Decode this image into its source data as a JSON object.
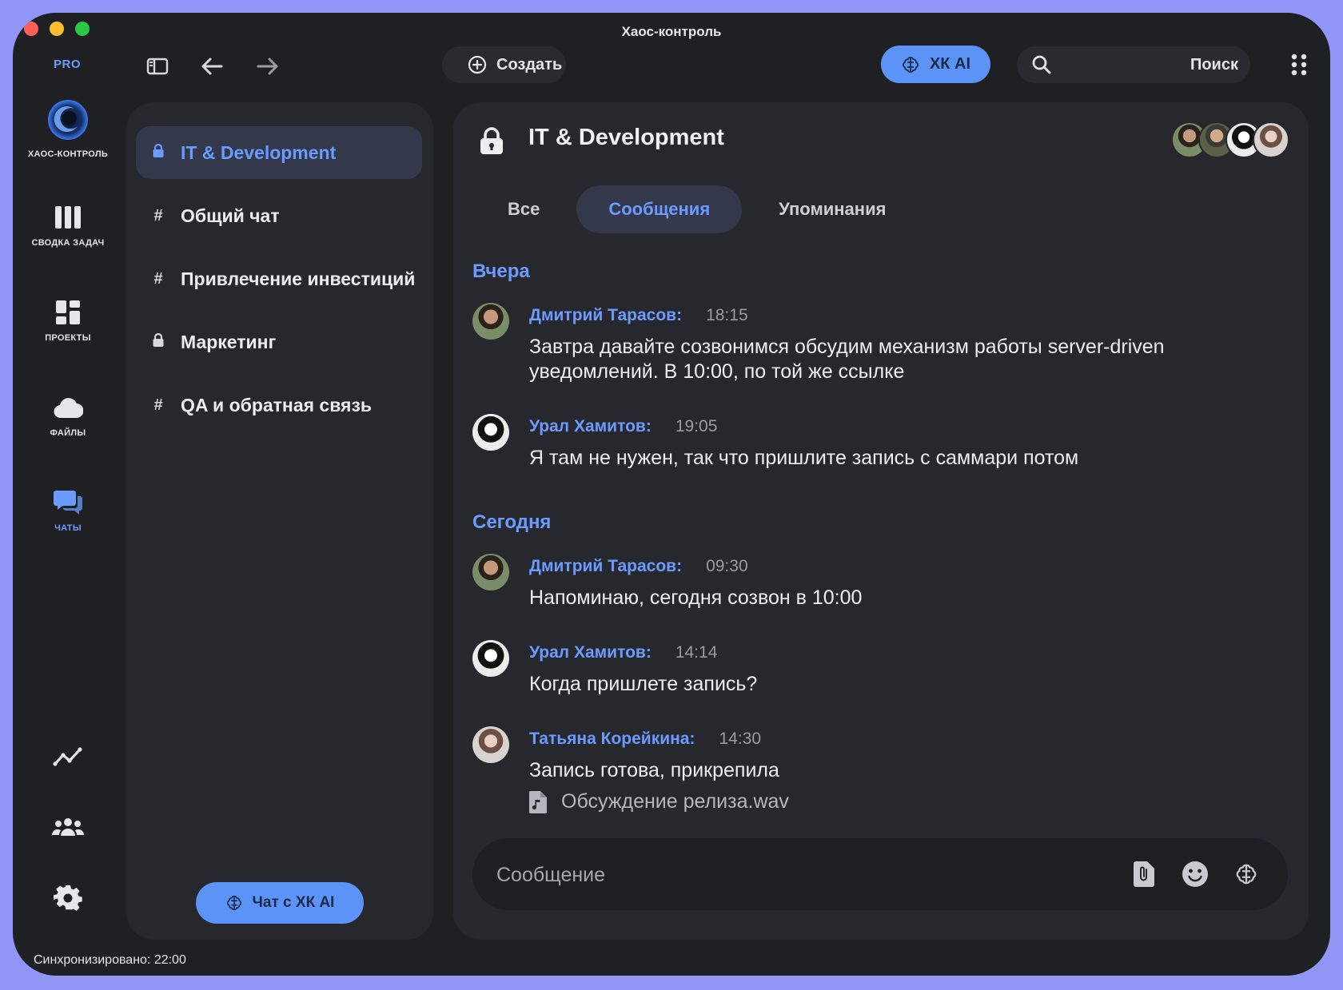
{
  "window": {
    "title": "Хаос-контроль"
  },
  "toolbar": {
    "pro_badge": "PRO",
    "create_label": "Создать",
    "ai_label": "ХК AI",
    "search_label": "Поиск"
  },
  "rail": {
    "logo_text": "ХАОС-КОНТРОЛЬ",
    "items": [
      {
        "label": "СВОДКА ЗАДАЧ",
        "icon": "columns-icon"
      },
      {
        "label": "ПРОЕКТЫ",
        "icon": "dashboard-icon"
      },
      {
        "label": "ФАЙЛЫ",
        "icon": "cloud-icon"
      },
      {
        "label": "ЧАТЫ",
        "icon": "chat-icon",
        "active": true
      }
    ],
    "bottom_icons": [
      "analytics-icon",
      "team-icon",
      "settings-icon"
    ]
  },
  "status": {
    "sync": "Синхронизировано: 22:00"
  },
  "channels": {
    "items": [
      {
        "name": "IT & Development",
        "type": "private",
        "active": true
      },
      {
        "name": "Общий чат",
        "type": "public"
      },
      {
        "name": "Привлечение инвестиций",
        "type": "public"
      },
      {
        "name": "Маркетинг",
        "type": "private"
      },
      {
        "name": "QA и обратная связь",
        "type": "public"
      }
    ],
    "hash": "#",
    "ai_chat_label": "Чат с ХК AI"
  },
  "chat": {
    "title": "IT & Development",
    "tabs": [
      "Все",
      "Сообщения",
      "Упоминания"
    ],
    "active_tab": "Сообщения",
    "days": [
      "Вчера",
      "Сегодня"
    ],
    "messages": [
      {
        "author": "Дмитрий Тарасов:",
        "time": "18:15",
        "text": "Завтра давайте созвонимся обсудим механизм работы server-driven уведомлений. В 10:00, по той же ссылке"
      },
      {
        "author": "Урал Хамитов:",
        "time": "19:05",
        "text": "Я там не нужен, так что пришлите запись с саммари потом"
      },
      {
        "author": "Дмитрий Тарасов:",
        "time": "09:30",
        "text": "Напоминаю, сегодня созвон в 10:00"
      },
      {
        "author": "Урал Хамитов:",
        "time": "14:14",
        "text": "Когда пришлете запись?"
      },
      {
        "author": "Татьяна Корейкина:",
        "time": "14:30",
        "text": "Запись готова, прикрепила",
        "attachment": "Обсуждение релиза.wav"
      }
    ],
    "composer_placeholder": "Сообщение"
  },
  "colors": {
    "accent": "#6b9bff",
    "ai_button": "#5b93f7",
    "background": "#1f2024",
    "panel": "#27282d",
    "frame": "#8f96f5"
  }
}
